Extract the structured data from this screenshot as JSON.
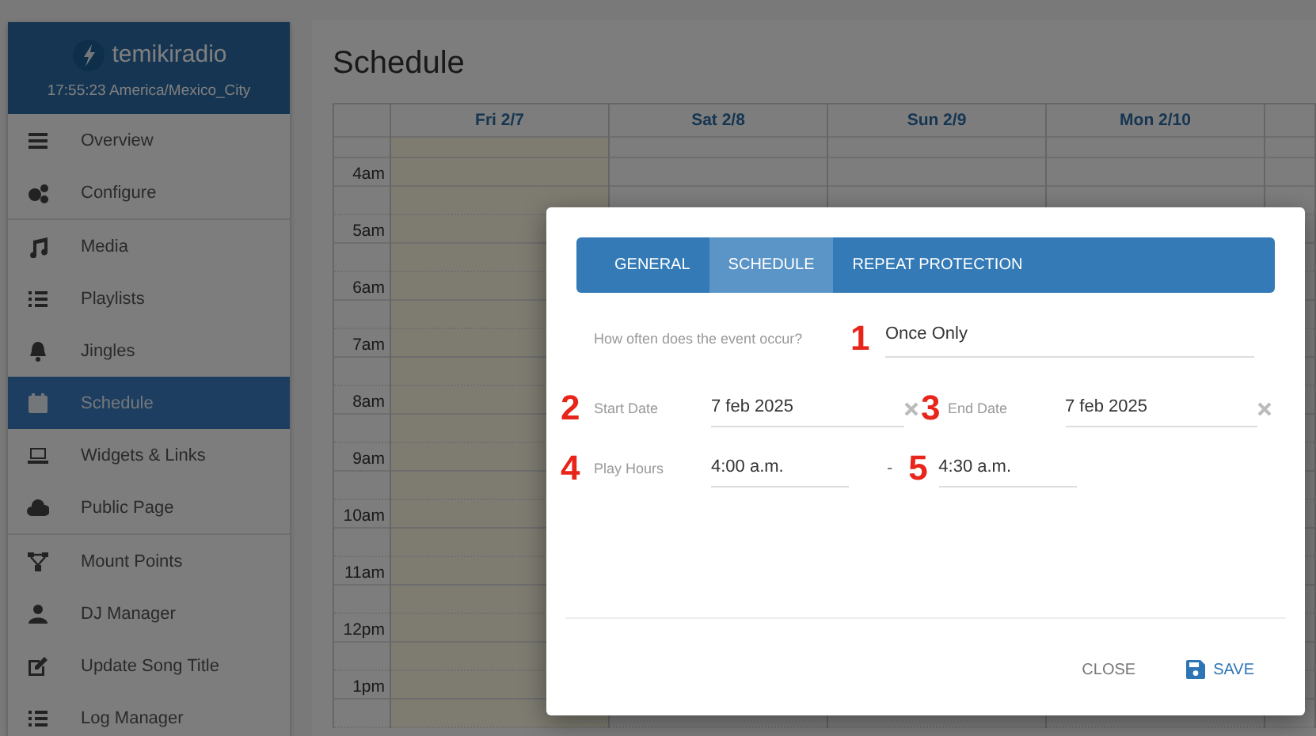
{
  "sidebar": {
    "brand": "temikiradio",
    "clock": "17:55:23 America/Mexico_City",
    "groups": [
      [
        {
          "label": "Overview",
          "selected": false
        },
        {
          "label": "Configure",
          "selected": false
        }
      ],
      [
        {
          "label": "Media",
          "selected": false
        },
        {
          "label": "Playlists",
          "selected": false
        },
        {
          "label": "Jingles",
          "selected": false
        },
        {
          "label": "Schedule",
          "selected": true
        },
        {
          "label": "Widgets & Links",
          "selected": false
        },
        {
          "label": "Public Page",
          "selected": false
        }
      ],
      [
        {
          "label": "Mount Points",
          "selected": false
        },
        {
          "label": "DJ Manager",
          "selected": false
        },
        {
          "label": "Update Song Title",
          "selected": false
        },
        {
          "label": "Log Manager",
          "selected": false
        }
      ]
    ]
  },
  "page": {
    "title": "Schedule"
  },
  "calendar": {
    "days": [
      {
        "label": "Fri 2/7",
        "today": true
      },
      {
        "label": "Sat 2/8",
        "today": false
      },
      {
        "label": "Sun 2/9",
        "today": false
      },
      {
        "label": "Mon 2/10",
        "today": false
      }
    ],
    "hours": [
      "4am",
      "5am",
      "6am",
      "7am",
      "8am",
      "9am",
      "10am",
      "11am",
      "12pm",
      "1pm"
    ]
  },
  "dialog": {
    "tabs": [
      {
        "label": "GENERAL",
        "selected": false
      },
      {
        "label": "SCHEDULE",
        "selected": true
      },
      {
        "label": "REPEAT PROTECTION",
        "selected": false
      }
    ],
    "frequency": {
      "marker": "1",
      "label": "How often does the event occur?",
      "value": "Once Only"
    },
    "start_date": {
      "marker": "2",
      "label": "Start Date",
      "value": "7 feb 2025"
    },
    "end_date": {
      "marker": "3",
      "label": "End Date",
      "value": "7 feb 2025"
    },
    "play_hours": {
      "label": "Play Hours",
      "separator": "-",
      "from": {
        "marker": "4",
        "value": "4:00 a.m."
      },
      "to": {
        "marker": "5",
        "value": "4:30 a.m."
      }
    },
    "buttons": [
      {
        "label": "CLOSE",
        "kind": "close"
      },
      {
        "label": "SAVE",
        "kind": "save"
      }
    ]
  }
}
